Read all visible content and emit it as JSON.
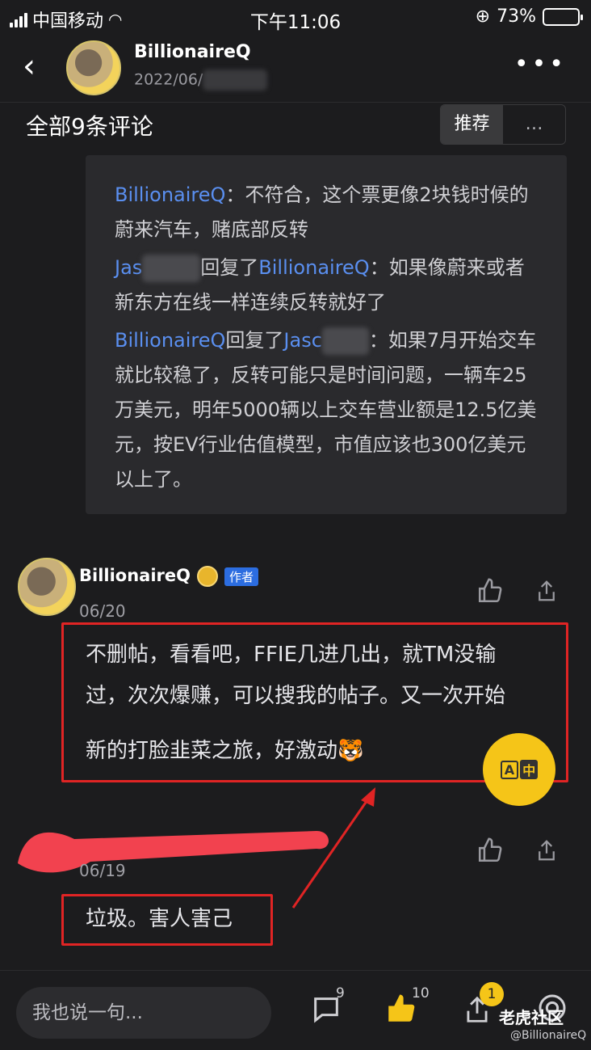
{
  "status": {
    "carrier": "中国移动",
    "time": "下午11:06",
    "battery": "73%",
    "battery_level": 0.73
  },
  "header": {
    "back_icon": "‹",
    "name": "BillionaireQ",
    "date": "2022/06/",
    "more": "•••"
  },
  "comments_header": {
    "title": "全部9条评论",
    "sort_options": [
      "推荐",
      "…"
    ]
  },
  "replies": [
    {
      "user": "BillionaireQ",
      "sep": "：",
      "text": "不符合，这个票更像2块钱时候的蔚来汽车，赌底部反转"
    },
    {
      "user": "Jas",
      "mid": "回复了",
      "target": "BillionaireQ",
      "sep": "：",
      "text": "如果像蔚来或者新东方在线一样连续反转就好了"
    },
    {
      "user": "BillionaireQ",
      "mid": "回复了",
      "target": "Jasc",
      "sep": "：",
      "text": "如果7月开始交车就比较稳了，反转可能只是时间问题，一辆车25万美元，明年5000辆以上交车营业额是12.5亿美元，按EV行业估值模型，市值应该也300亿美元以上了。"
    }
  ],
  "comment1": {
    "name": "BillionaireQ",
    "author_badge": "作者",
    "date": "06/20",
    "text_lines": [
      "不删帖，看看吧，FFIE几进几出，就TM没输",
      "过，次次爆赚，可以搜我的帖子。又一次开始",
      "新的打脸韭菜之旅，好激动"
    ],
    "emoji": "🐯"
  },
  "comment2": {
    "date": "06/19",
    "text": "垃圾。害人害己"
  },
  "translate_button": {
    "top": "A",
    "bottom": "中"
  },
  "bottom_bar": {
    "input_placeholder": "我也说一句...",
    "comment_count": "9",
    "like_count": "10",
    "share_badge": "1",
    "brand": "老虎社区",
    "handle": "@BillionaireQ"
  },
  "colors": {
    "accent_link": "#5a8ff0",
    "highlight": "#e02424",
    "brand_yellow": "#f5c518"
  }
}
